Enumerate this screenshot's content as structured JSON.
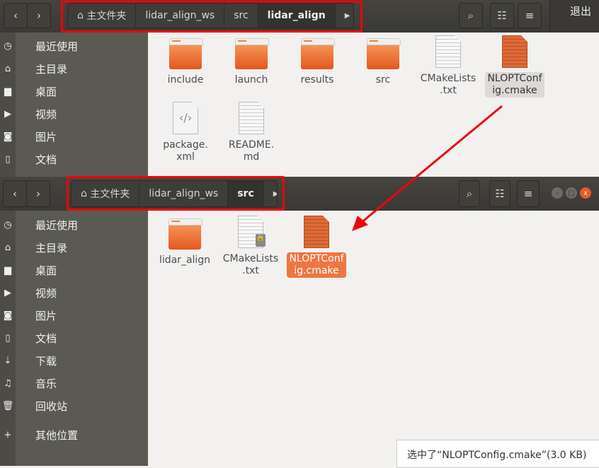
{
  "top_window": {
    "breadcrumb": [
      "主文件夹",
      "lidar_align_ws",
      "src",
      "lidar_align"
    ],
    "active_crumb": "lidar_align",
    "quit_label": "退出",
    "sidebar": [
      {
        "icon": "clock-icon",
        "label": "最近使用"
      },
      {
        "icon": "home-icon",
        "label": "主目录"
      },
      {
        "icon": "folder-icon",
        "label": "桌面"
      },
      {
        "icon": "video-icon",
        "label": "视频"
      },
      {
        "icon": "camera-icon",
        "label": "图片"
      },
      {
        "icon": "document-icon",
        "label": "文档"
      }
    ],
    "files": [
      {
        "name": "include",
        "type": "folder"
      },
      {
        "name": "launch",
        "type": "folder"
      },
      {
        "name": "results",
        "type": "folder"
      },
      {
        "name": "src",
        "type": "folder"
      },
      {
        "name": "CMakeLists\n.txt",
        "type": "text"
      },
      {
        "name": "NLOPTConf\nig.cmake",
        "type": "cmake",
        "state": "hover"
      },
      {
        "name": "package.\nxml",
        "type": "xml"
      },
      {
        "name": "README.\nmd",
        "type": "text"
      }
    ]
  },
  "bottom_window": {
    "breadcrumb": [
      "主文件夹",
      "lidar_align_ws",
      "src"
    ],
    "active_crumb": "src",
    "sidebar": [
      {
        "icon": "clock-icon",
        "label": "最近使用"
      },
      {
        "icon": "home-icon",
        "label": "主目录"
      },
      {
        "icon": "folder-icon",
        "label": "桌面"
      },
      {
        "icon": "video-icon",
        "label": "视频"
      },
      {
        "icon": "camera-icon",
        "label": "图片"
      },
      {
        "icon": "document-icon",
        "label": "文档"
      },
      {
        "icon": "download-icon",
        "label": "下载"
      },
      {
        "icon": "music-icon",
        "label": "音乐"
      },
      {
        "icon": "trash-icon",
        "label": "回收站"
      },
      {
        "icon": "plus-icon",
        "label": "其他位置"
      }
    ],
    "files": [
      {
        "name": "lidar_align",
        "type": "folder"
      },
      {
        "name": "CMakeLists\n.txt",
        "type": "text-locked"
      },
      {
        "name": "NLOPTConf\nig.cmake",
        "type": "cmake",
        "state": "selected"
      }
    ],
    "status": "选中了“NLOPTConfig.cmake”(3.0 KB)"
  },
  "annotation_color": "#f2000b",
  "selection_color": "#ef7543"
}
